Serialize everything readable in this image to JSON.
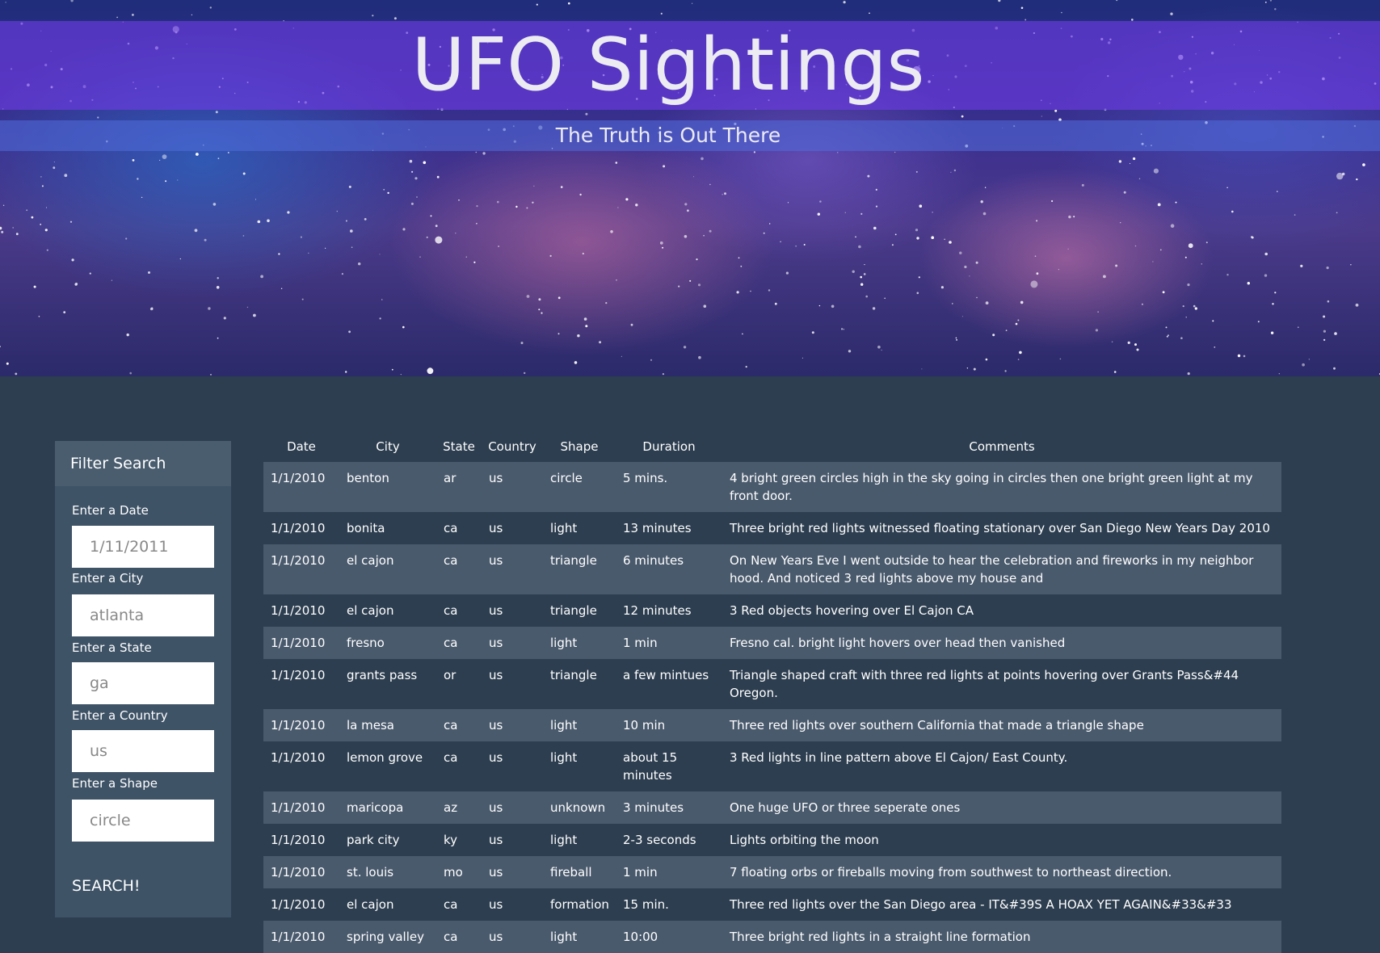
{
  "header": {
    "title": "UFO Sightings",
    "subtitle": "The Truth is Out There"
  },
  "sidebar": {
    "title": "Filter Search",
    "fields": [
      {
        "label": "Enter a Date",
        "placeholder": "1/11/2011"
      },
      {
        "label": "Enter a City",
        "placeholder": "atlanta"
      },
      {
        "label": "Enter a State",
        "placeholder": "ga"
      },
      {
        "label": "Enter a Country",
        "placeholder": "us"
      },
      {
        "label": "Enter a Shape",
        "placeholder": "circle"
      }
    ],
    "search_label": "SEARCH!"
  },
  "table": {
    "columns": [
      "Date",
      "City",
      "State",
      "Country",
      "Shape",
      "Duration",
      "Comments"
    ],
    "rows": [
      [
        "1/1/2010",
        "benton",
        "ar",
        "us",
        "circle",
        "5 mins.",
        "4 bright green circles high in the sky going in circles then one bright green light at my front door."
      ],
      [
        "1/1/2010",
        "bonita",
        "ca",
        "us",
        "light",
        "13 minutes",
        "Three bright red lights witnessed floating stationary over San Diego New Years Day 2010"
      ],
      [
        "1/1/2010",
        "el cajon",
        "ca",
        "us",
        "triangle",
        "6 minutes",
        "On New Years Eve I went outside to hear the celebration and fireworks in my neighbor hood. And noticed 3 red lights above my house and"
      ],
      [
        "1/1/2010",
        "el cajon",
        "ca",
        "us",
        "triangle",
        "12 minutes",
        "3 Red objects hovering over El Cajon CA"
      ],
      [
        "1/1/2010",
        "fresno",
        "ca",
        "us",
        "light",
        "1 min",
        "Fresno cal. bright light hovers over head then vanished"
      ],
      [
        "1/1/2010",
        "grants pass",
        "or",
        "us",
        "triangle",
        "a few mintues",
        "Triangle shaped craft with three red lights at points hovering over Grants Pass&#44 Oregon."
      ],
      [
        "1/1/2010",
        "la mesa",
        "ca",
        "us",
        "light",
        "10 min",
        "Three red lights over southern California that made a triangle shape"
      ],
      [
        "1/1/2010",
        "lemon grove",
        "ca",
        "us",
        "light",
        "about 15 minutes",
        "3 Red lights in line pattern above El Cajon/ East County."
      ],
      [
        "1/1/2010",
        "maricopa",
        "az",
        "us",
        "unknown",
        "3 minutes",
        "One huge UFO or three seperate ones"
      ],
      [
        "1/1/2010",
        "park city",
        "ky",
        "us",
        "light",
        "2-3 seconds",
        "Lights orbiting the moon"
      ],
      [
        "1/1/2010",
        "st. louis",
        "mo",
        "us",
        "fireball",
        "1 min",
        "7 floating orbs or fireballs moving from southwest to northeast direction."
      ],
      [
        "1/1/2010",
        "el cajon",
        "ca",
        "us",
        "formation",
        "15 min.",
        "Three red lights over the San Diego area - IT&#39S A HOAX YET AGAIN&#33&#33"
      ],
      [
        "1/1/2010",
        "spring valley",
        "ca",
        "us",
        "light",
        "10:00",
        "Three bright red lights in a straight line formation"
      ]
    ]
  }
}
